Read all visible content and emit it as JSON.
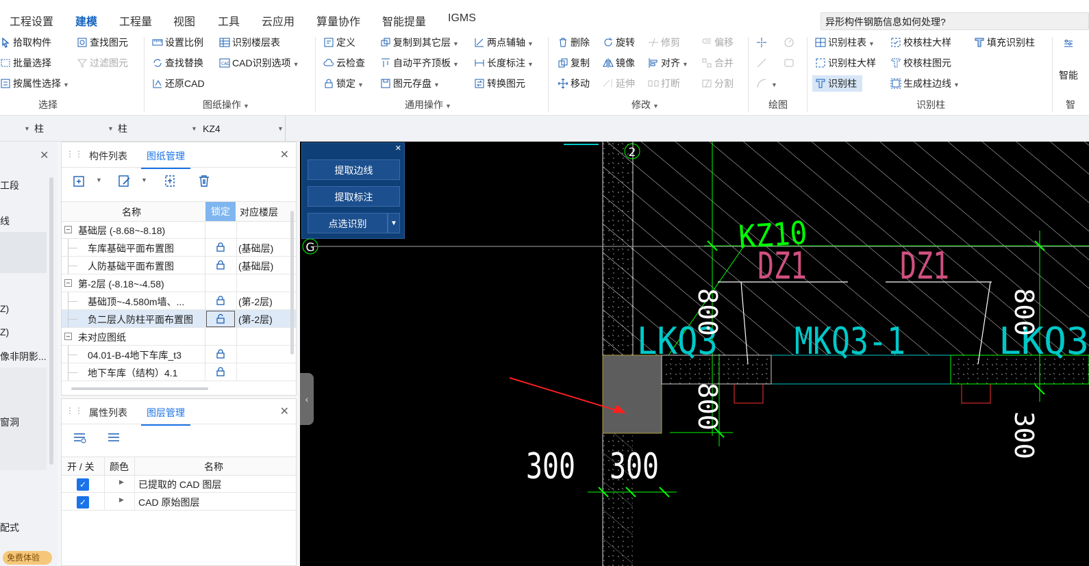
{
  "menu": {
    "items": [
      "工程设置",
      "建模",
      "工程量",
      "视图",
      "工具",
      "云应用",
      "算量协作",
      "智能提量",
      "IGMS"
    ],
    "active_index": 1,
    "help_search": "异形构件钢筋信息如何处理?"
  },
  "ribbon": {
    "select": {
      "label": "选择",
      "pick": "拾取构件",
      "batch": "批量选择",
      "by_attr": "按属性选择",
      "find": "查找图元",
      "filter": "过滤图元"
    },
    "drawing": {
      "label": "图纸操作",
      "set_scale": "设置比例",
      "find_replace": "查找替换",
      "restore_cad": "还原CAD",
      "identify_floors": "识别楼层表",
      "cad_options": "CAD识别选项"
    },
    "common": {
      "label": "通用操作",
      "define": "定义",
      "cloud_check": "云检查",
      "lock": "锁定",
      "copy_to_floor": "复制到其它层",
      "auto_align": "自动平齐顶板",
      "save_element": "图元存盘",
      "two_point_axis": "两点辅轴",
      "length_dim": "长度标注",
      "convert": "转换图元"
    },
    "modify": {
      "label": "修改",
      "delete": "删除",
      "copy": "复制",
      "move": "移动",
      "rotate": "旋转",
      "mirror": "镜像",
      "extend": "延伸",
      "trim": "修剪",
      "align": "对齐",
      "break": "打断",
      "offset": "偏移",
      "merge": "合并",
      "split": "分割"
    },
    "draw": {
      "label": "绘图"
    },
    "identify_column": {
      "label": "识别柱",
      "col_table": "识别柱表",
      "col_detail": "识别柱大样",
      "identify_col": "识别柱",
      "check_detail": "校核柱大样",
      "check_elem": "校核柱图元",
      "gen_edge": "生成柱边线",
      "fill_identify": "填充识别柱"
    },
    "smart": {
      "label": "智能",
      "label2": "智"
    }
  },
  "filters": {
    "combo1": "柱",
    "combo2": "柱",
    "combo3": "KZ4"
  },
  "left_panel": {
    "items": [
      "工段",
      "线",
      "Z)",
      "Z)",
      "像非阴影...",
      "窗洞",
      "配式"
    ],
    "free_badge": "免费体验"
  },
  "drawing_panel": {
    "tabs": [
      "构件列表",
      "图纸管理"
    ],
    "active_tab": 1,
    "columns": {
      "name": "名称",
      "lock": "锁定",
      "floor": "对应楼层"
    },
    "rows": [
      {
        "type": "group",
        "name": "基础层 (-8.68~-8.18)"
      },
      {
        "type": "item",
        "name": "车库基础平面布置图",
        "floor": "(基础层)",
        "locked": true
      },
      {
        "type": "item",
        "name": "人防基础平面布置图",
        "floor": "(基础层)",
        "locked": true
      },
      {
        "type": "group",
        "name": "第-2层 (-8.18~-4.58)"
      },
      {
        "type": "item",
        "name": "基础顶~-4.580m墙、...",
        "floor": "(第-2层)",
        "locked": true
      },
      {
        "type": "item",
        "name": "负二层人防柱平面布置图",
        "floor": "(第-2层)",
        "locked": false,
        "selected": true
      },
      {
        "type": "group",
        "name": "未对应图纸"
      },
      {
        "type": "item",
        "name": "04.01-B-4地下车库_t3",
        "floor": "",
        "locked": true
      },
      {
        "type": "item",
        "name": "地下车库（结构）4.1",
        "floor": "",
        "locked": true
      }
    ]
  },
  "layer_panel": {
    "tabs": [
      "属性列表",
      "图层管理"
    ],
    "active_tab": 1,
    "columns": {
      "onoff": "开 / 关",
      "color": "颜色",
      "name": "名称"
    },
    "rows": [
      {
        "checked": true,
        "name": "已提取的 CAD 图层"
      },
      {
        "checked": true,
        "name": "CAD 原始图层"
      }
    ]
  },
  "float_panel": {
    "extract_edge": "提取边线",
    "extract_label": "提取标注",
    "point_identify": "点选识别"
  },
  "cad": {
    "axis_num": "2",
    "axis_letter": "G",
    "col_label": "KZ10",
    "dz_left": "DZ1",
    "dz_right": "DZ1",
    "wall_left": "LKQ3",
    "wall_mid": "MKQ3-1",
    "wall_right": "LKQ3",
    "dim_1": "300",
    "dim_2": "300",
    "dim_v1": "800",
    "dim_v2": "800",
    "dim_v3": "800",
    "dim_v4": "300"
  },
  "colors": {
    "accent": "#1a73e8",
    "float_bg": "#0f3f77",
    "cad_green": "#00ff00",
    "cad_cyan": "#00c8c8",
    "cad_pink": "#d05080",
    "cad_red": "#ff3030"
  }
}
